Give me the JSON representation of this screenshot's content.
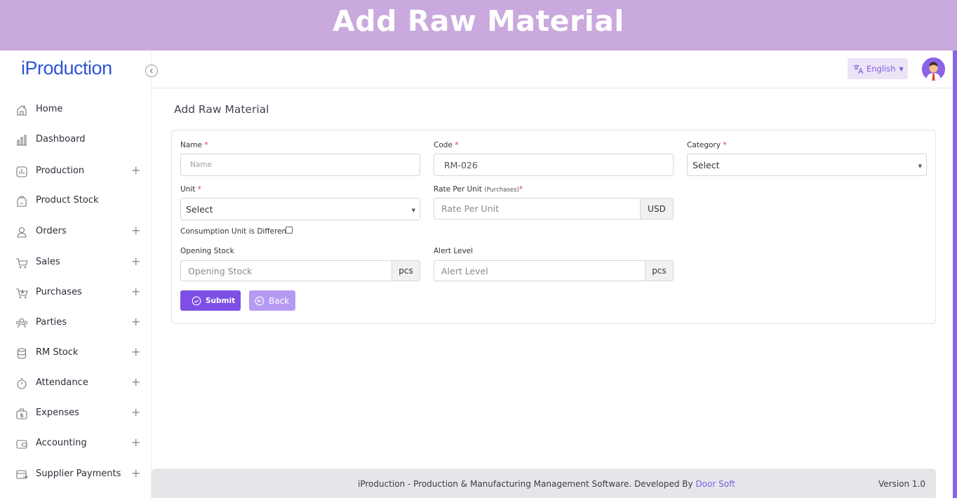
{
  "banner": {
    "title": "Add Raw Material"
  },
  "app": {
    "logo": "iProduction"
  },
  "sidebar": {
    "items": [
      {
        "label": "Home",
        "icon": "home-icon",
        "expandable": false
      },
      {
        "label": "Dashboard",
        "icon": "bar-chart-icon",
        "expandable": false
      },
      {
        "label": "Production",
        "icon": "production-chart-icon",
        "expandable": true
      },
      {
        "label": "Product Stock",
        "icon": "stock-bag-icon",
        "expandable": false
      },
      {
        "label": "Orders",
        "icon": "user-icon",
        "expandable": true
      },
      {
        "label": "Sales",
        "icon": "cart-icon",
        "expandable": true
      },
      {
        "label": "Purchases",
        "icon": "cart-download-icon",
        "expandable": true
      },
      {
        "label": "Parties",
        "icon": "group-icon",
        "expandable": true
      },
      {
        "label": "RM Stock",
        "icon": "database-icon",
        "expandable": true
      },
      {
        "label": "Attendance",
        "icon": "stopwatch-icon",
        "expandable": true
      },
      {
        "label": "Expenses",
        "icon": "money-bag-icon",
        "expandable": true
      },
      {
        "label": "Accounting",
        "icon": "wallet-icon",
        "expandable": true
      },
      {
        "label": "Supplier Payments",
        "icon": "payment-card-icon",
        "expandable": true
      }
    ],
    "plus_symbol": "+"
  },
  "topbar": {
    "language": "English",
    "language_icon": "translate-icon",
    "avatar_icon": "user-avatar-icon"
  },
  "page": {
    "title": "Add Raw Material"
  },
  "form": {
    "name": {
      "label": "Name",
      "required_mark": "*",
      "placeholder": "Name"
    },
    "code": {
      "label": "Code",
      "required_mark": "*",
      "value": "RM-026"
    },
    "category": {
      "label": "Category",
      "required_mark": "*",
      "selected": "Select"
    },
    "unit": {
      "label": "Unit",
      "required_mark": "*",
      "selected": "Select"
    },
    "rate": {
      "label": "Rate Per Unit",
      "label_note": "(Purchases)",
      "required_mark": "*",
      "placeholder": "Rate Per Unit",
      "addon": "USD"
    },
    "consumption": {
      "label": "Consumption Unit is Different",
      "checked": false
    },
    "opening_stock": {
      "label": "Opening Stock",
      "placeholder": "Opening Stock",
      "addon": "pcs"
    },
    "alert_level": {
      "label": "Alert Level",
      "placeholder": "Alert Level",
      "addon": "pcs"
    },
    "submit_label": "Submit",
    "back_label": "Back"
  },
  "footer": {
    "text": "iProduction - Production & Manufacturing Management Software. Developed By ",
    "link": "Door Soft",
    "version": "Version 1.0"
  },
  "colors": {
    "accent": "#7d4fe6",
    "banner": "#c9a9de",
    "logo": "#2d55d6",
    "required": "#e53935"
  }
}
